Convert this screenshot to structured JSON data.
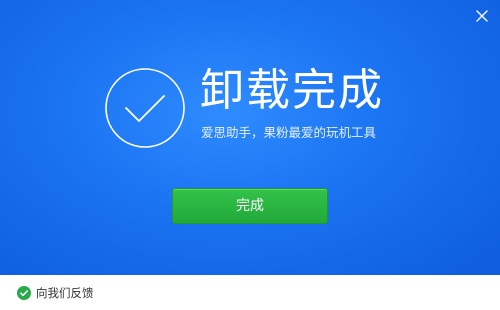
{
  "window": {
    "close_icon": "close-icon"
  },
  "hero": {
    "status_icon": "check-circle-icon",
    "title": "卸载完成",
    "subtitle": "爱思助手，果粉最爱的玩机工具",
    "background_color": "#1b74f2"
  },
  "actions": {
    "done_label": "完成",
    "done_color": "#22a93a"
  },
  "footer": {
    "feedback_icon": "check-badge-icon",
    "feedback_label": "向我们反馈",
    "feedback_icon_color": "#2aa94a"
  }
}
